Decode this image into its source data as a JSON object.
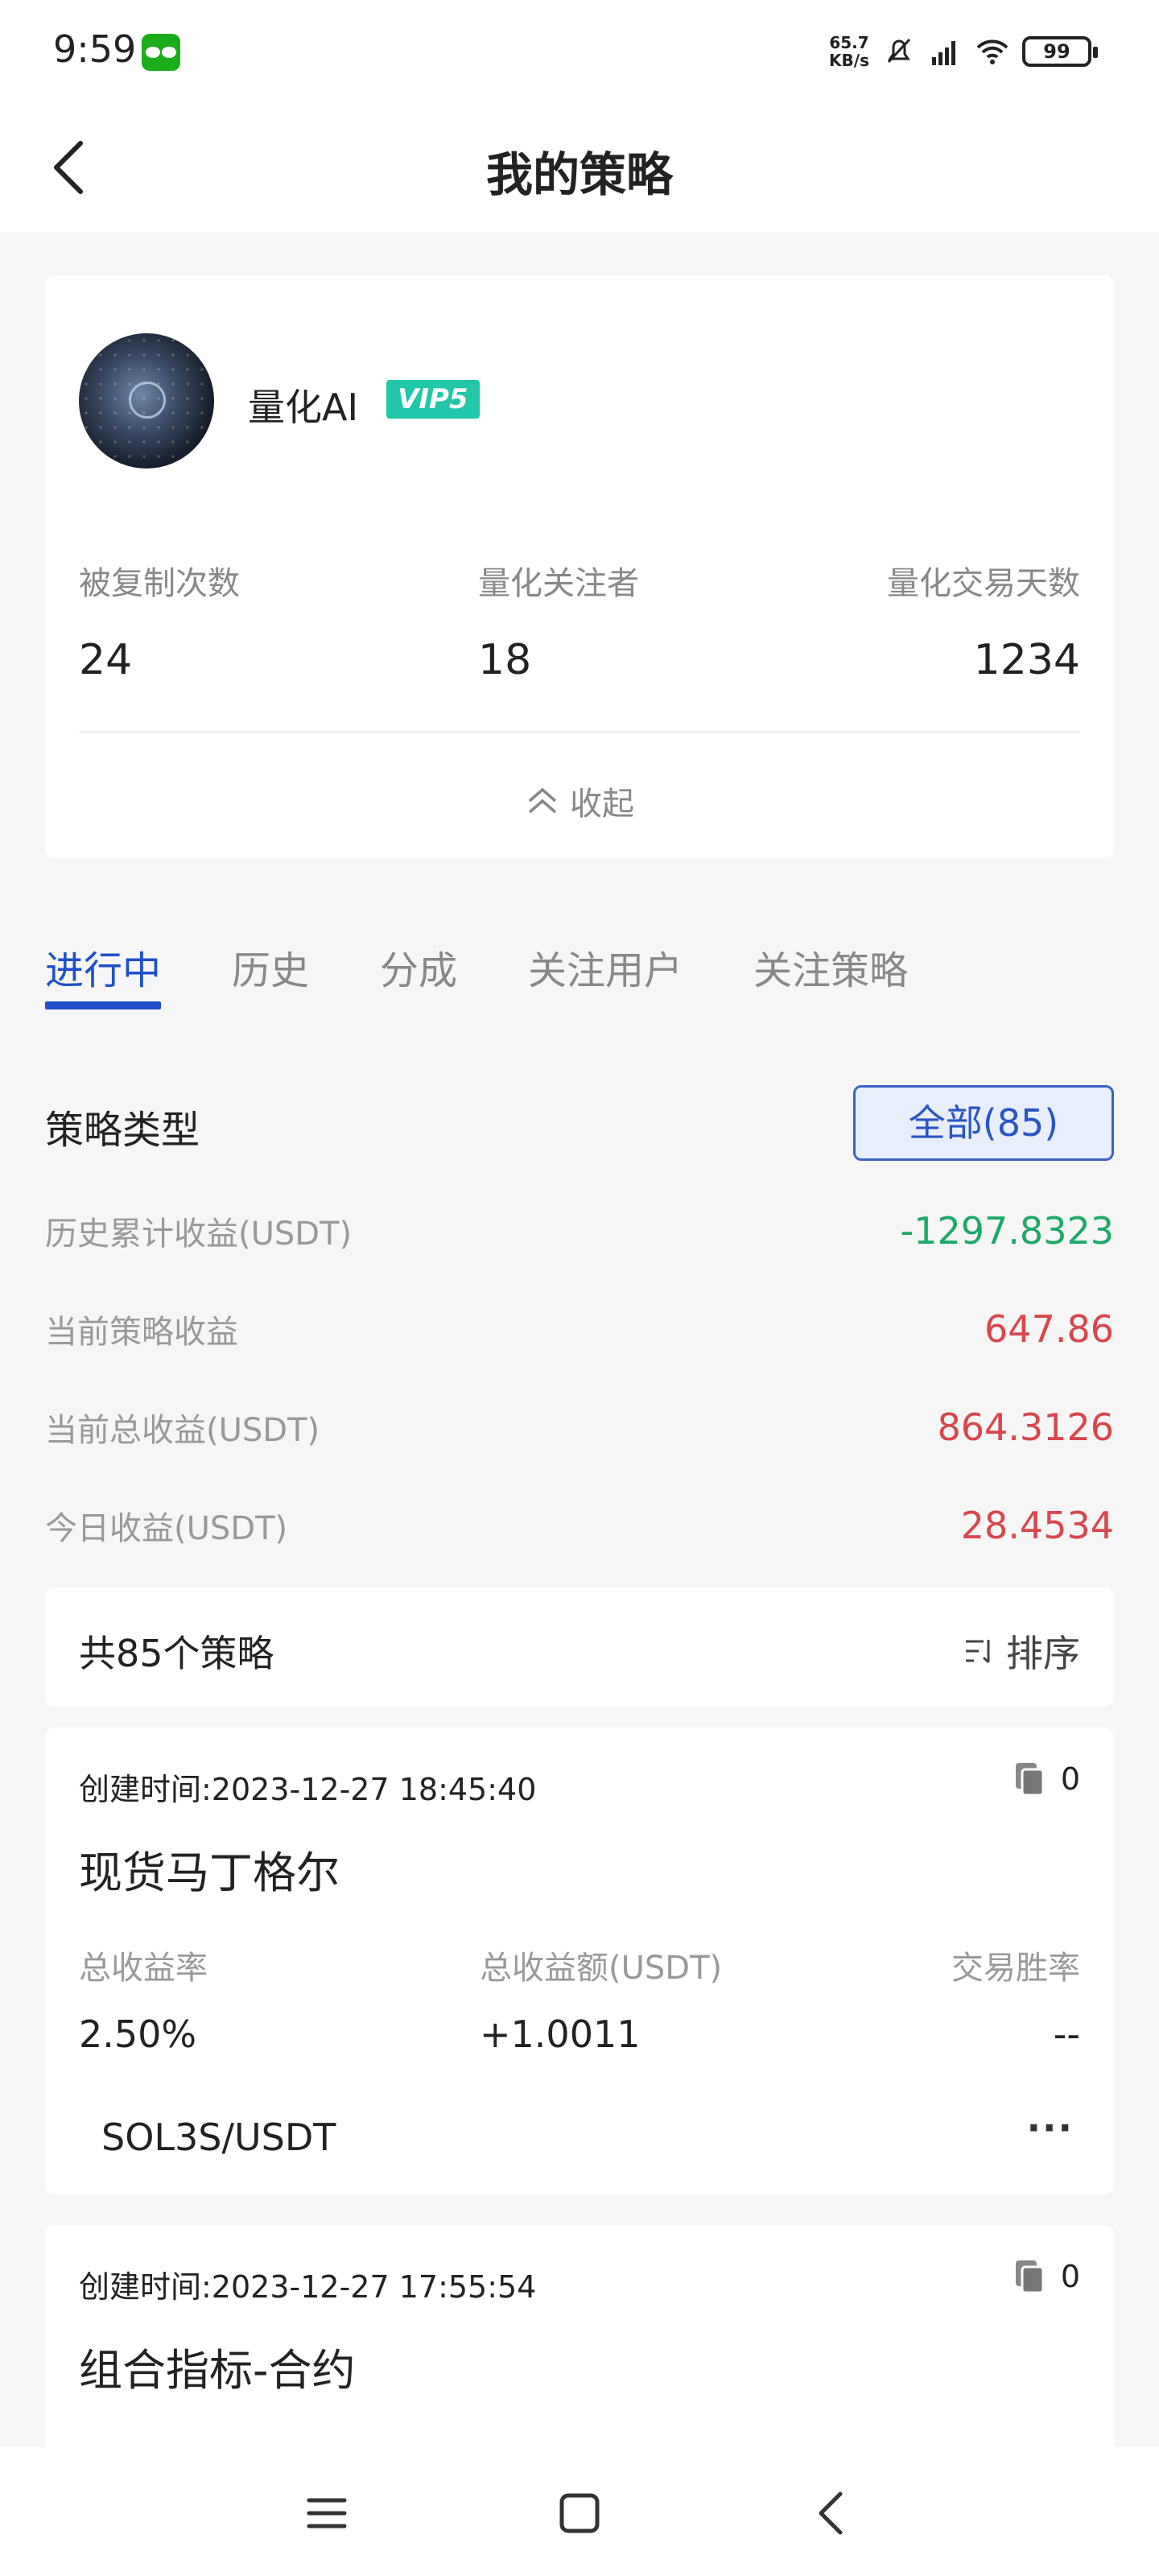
{
  "status_bar": {
    "time": "9:59",
    "speed_top": "65.7",
    "speed_bottom": "KB/s",
    "battery": "99"
  },
  "header": {
    "title": "我的策略"
  },
  "profile": {
    "name": "量化AI",
    "vip": "VIP5",
    "stats": [
      {
        "label": "被复制次数",
        "value": "24"
      },
      {
        "label": "量化关注者",
        "value": "18"
      },
      {
        "label": "量化交易天数",
        "value": "1234"
      }
    ],
    "collapse_label": "收起"
  },
  "tabs": [
    "进行中",
    "历史",
    "分成",
    "关注用户",
    "关注策略"
  ],
  "filter": {
    "label": "策略类型",
    "button": "全部(85)"
  },
  "summary": [
    {
      "label": "历史累计收益(USDT)",
      "value": "-1297.8323",
      "color": "#1ca96a"
    },
    {
      "label": "当前策略收益",
      "value": "647.86",
      "color": "#d9464e"
    },
    {
      "label": "当前总收益(USDT)",
      "value": "864.3126",
      "color": "#d9464e"
    },
    {
      "label": "今日收益(USDT)",
      "value": "28.4534",
      "color": "#d9464e"
    }
  ],
  "list": {
    "count_text": "共85个策略",
    "sort_label": "排序"
  },
  "strategies": [
    {
      "time": "创建时间:2023-12-27 18:45:40",
      "copies": "0",
      "name": "现货马丁格尔",
      "col1_label": "总收益率",
      "col1_value": "2.50%",
      "col2_label": "总收益额(USDT)",
      "col2_value": "+1.0011",
      "col3_label": "交易胜率",
      "col3_value": "--",
      "pair": "SOL3S/USDT",
      "more": "···"
    },
    {
      "time": "创建时间:2023-12-27 17:55:54",
      "copies": "0",
      "name": "组合指标-合约"
    }
  ]
}
